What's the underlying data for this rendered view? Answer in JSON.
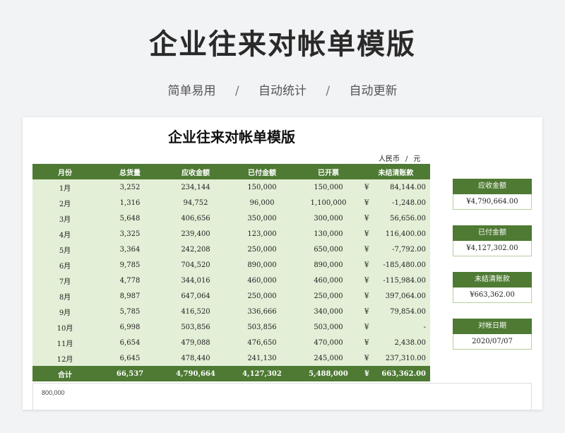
{
  "banner": {
    "title": "企业往来对帐单模版",
    "features": [
      "简单易用",
      "自动统计",
      "自动更新"
    ],
    "separator": "/"
  },
  "sheet": {
    "title": "企业往来对帐单模版",
    "currency_label": "人民币",
    "currency_sep": "/",
    "currency_unit": "元"
  },
  "table": {
    "headers": [
      "月份",
      "总货量",
      "应收金额",
      "已付金额",
      "已开票",
      "未结清账款"
    ],
    "currency_symbol": "¥",
    "rows": [
      {
        "month": "1月",
        "qty": "3,252",
        "receivable": "234,144",
        "paid": "150,000",
        "invoiced": "150,000",
        "outstanding": "84,144.00"
      },
      {
        "month": "2月",
        "qty": "1,316",
        "receivable": "94,752",
        "paid": "96,000",
        "invoiced": "1,100,000",
        "outstanding": "-1,248.00"
      },
      {
        "month": "3月",
        "qty": "5,648",
        "receivable": "406,656",
        "paid": "350,000",
        "invoiced": "300,000",
        "outstanding": "56,656.00"
      },
      {
        "month": "4月",
        "qty": "3,325",
        "receivable": "239,400",
        "paid": "123,000",
        "invoiced": "130,000",
        "outstanding": "116,400.00"
      },
      {
        "month": "5月",
        "qty": "3,364",
        "receivable": "242,208",
        "paid": "250,000",
        "invoiced": "650,000",
        "outstanding": "-7,792.00"
      },
      {
        "month": "6月",
        "qty": "9,785",
        "receivable": "704,520",
        "paid": "890,000",
        "invoiced": "890,000",
        "outstanding": "-185,480.00"
      },
      {
        "month": "7月",
        "qty": "4,778",
        "receivable": "344,016",
        "paid": "460,000",
        "invoiced": "460,000",
        "outstanding": "-115,984.00"
      },
      {
        "month": "8月",
        "qty": "8,987",
        "receivable": "647,064",
        "paid": "250,000",
        "invoiced": "250,000",
        "outstanding": "397,064.00"
      },
      {
        "month": "9月",
        "qty": "5,785",
        "receivable": "416,520",
        "paid": "336,666",
        "invoiced": "340,000",
        "outstanding": "79,854.00"
      },
      {
        "month": "10月",
        "qty": "6,998",
        "receivable": "503,856",
        "paid": "503,856",
        "invoiced": "503,000",
        "outstanding": "-"
      },
      {
        "month": "11月",
        "qty": "6,654",
        "receivable": "479,088",
        "paid": "476,650",
        "invoiced": "470,000",
        "outstanding": "2,438.00"
      },
      {
        "month": "12月",
        "qty": "6,645",
        "receivable": "478,440",
        "paid": "241,130",
        "invoiced": "245,000",
        "outstanding": "237,310.00"
      }
    ],
    "total": {
      "month": "合计",
      "qty": "66,537",
      "receivable": "4,790,664",
      "paid": "4,127,302",
      "invoiced": "5,488,000",
      "outstanding": "663,362.00"
    }
  },
  "summary": [
    {
      "label": "应收金额",
      "value": "¥4,790,664.00"
    },
    {
      "label": "已付金额",
      "value": "¥4,127,302.00"
    },
    {
      "label": "未结清账款",
      "value": "¥663,362.00"
    },
    {
      "label": "对帐日期",
      "value": "2020/07/07"
    }
  ],
  "chart": {
    "tick_labels": [
      "800,000"
    ]
  },
  "colors": {
    "header_green": "#4e7a33",
    "row_green": "#e3efd7",
    "page_bg": "#f2f3f5"
  }
}
